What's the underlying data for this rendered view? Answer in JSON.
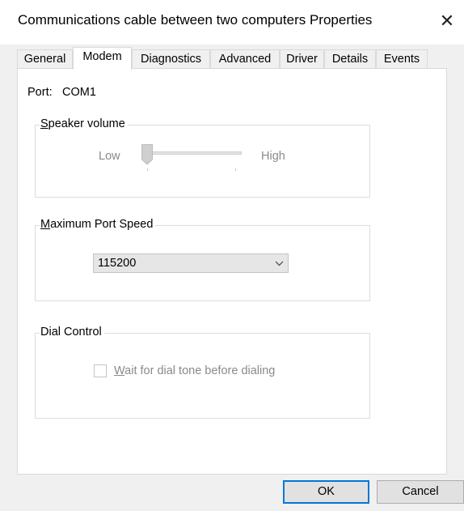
{
  "window": {
    "title": "Communications cable between two computers Properties",
    "close_glyph": "✕"
  },
  "tabs": [
    {
      "label": "General",
      "active": false
    },
    {
      "label": "Modem",
      "active": true
    },
    {
      "label": "Diagnostics",
      "active": false
    },
    {
      "label": "Advanced",
      "active": false
    },
    {
      "label": "Driver",
      "active": false
    },
    {
      "label": "Details",
      "active": false
    },
    {
      "label": "Events",
      "active": false
    }
  ],
  "modem": {
    "port_label": "Port:",
    "port_value": "COM1",
    "speaker_volume": {
      "title_access_key": "S",
      "title_rest": "peaker volume",
      "low_label": "Low",
      "high_label": "High",
      "level": 0,
      "enabled": false
    },
    "max_port_speed": {
      "title_access_key": "M",
      "title_rest": "aximum Port Speed",
      "selected_value": "115200",
      "arrow_glyph": "⌵"
    },
    "dial_control": {
      "title": "Dial Control",
      "wait_checkbox_access_key": "W",
      "wait_checkbox_rest": "ait for dial tone before dialing",
      "wait_checked": false,
      "enabled": false
    }
  },
  "buttons": {
    "ok_label": "OK",
    "cancel_label": "Cancel"
  },
  "colors": {
    "accent": "#0078d7",
    "disabled_text": "#8a8a8a",
    "panel_bg": "#ffffff",
    "window_bg": "#f0f0f0"
  }
}
